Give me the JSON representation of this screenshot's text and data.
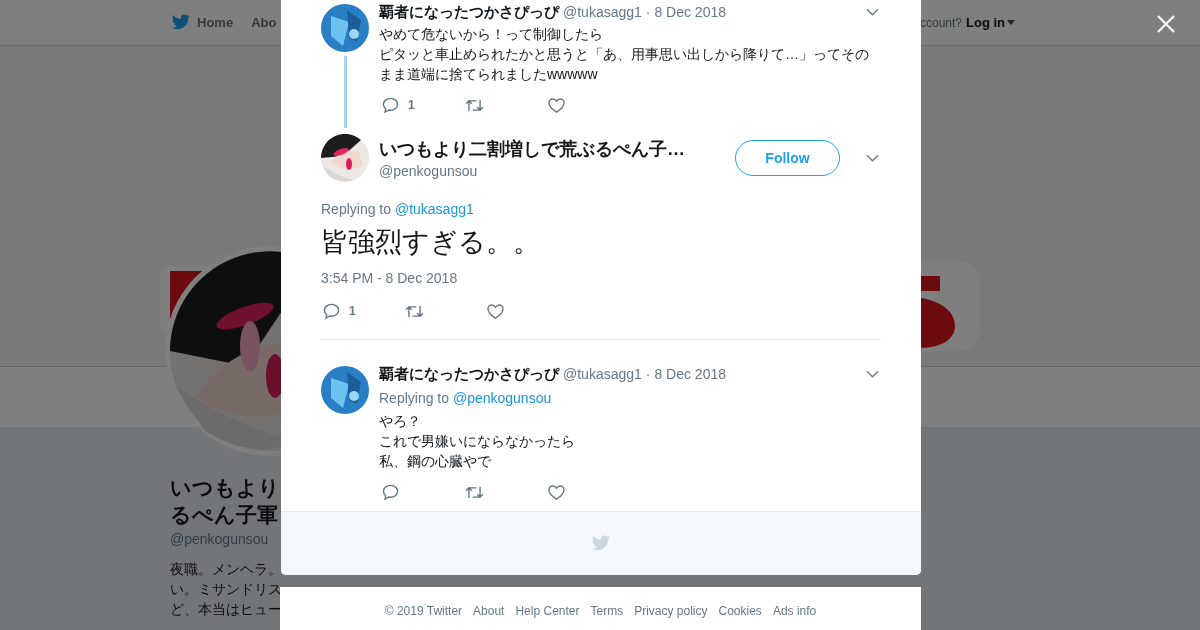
{
  "nav": {
    "items": [
      "Home",
      "Abo"
    ],
    "account_prompt": "ccount?",
    "login": "Log in"
  },
  "profile": {
    "name_lines": [
      "いつもより",
      "るぺん子軍"
    ],
    "handle": "@penkogunsou",
    "bio_lines": [
      "夜職。メンヘラ。",
      "い。ミサンドリス",
      "ど、本当はヒュー"
    ]
  },
  "tweets": [
    {
      "kind": "thread",
      "name": "覇者になったつかさぴっぴ",
      "handle": "@tukasagg1",
      "date": "· 8 Dec 2018",
      "lines": [
        "やめて危ないから！って制御したら",
        "ピタッと車止められたかと思うと「あ、用事思い出しから降りて…」ってその",
        "まま道端に捨てられましたwwwww"
      ],
      "replies": "1"
    },
    {
      "kind": "main",
      "name": "いつもより二割増しで荒ぶるぺん子…",
      "handle": "@penkogunsou",
      "follow": "Follow",
      "replying_label": "Replying to",
      "replying_to": "@tukasagg1",
      "lines": [
        "皆強烈すぎる。。"
      ],
      "time": "3:54 PM - 8 Dec 2018",
      "replies": "1"
    },
    {
      "kind": "reply",
      "name": "覇者になったつかさぴっぴ",
      "handle": "@tukasagg1",
      "date": "· 8 Dec 2018",
      "replying_label": "Replying to",
      "replying_to": "@penkogunsou",
      "lines": [
        "やろ？",
        "これで男嫌いにならなかったら",
        "私、鋼の心臓やで"
      ]
    }
  ],
  "footer_links": [
    "© 2019 Twitter",
    "About",
    "Help Center",
    "Terms",
    "Privacy policy",
    "Cookies",
    "Ads info"
  ]
}
